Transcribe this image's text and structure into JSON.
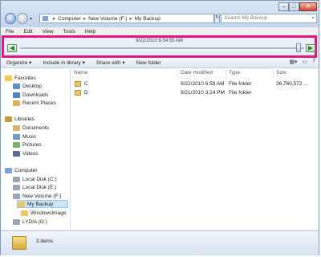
{
  "titlebar": {
    "minimize": "–",
    "maximize": "□",
    "close": "✕"
  },
  "address": {
    "crumbs": [
      "Computer",
      "New Volume (F:)",
      "My Backup"
    ]
  },
  "search": {
    "placeholder": "Search My Backup"
  },
  "menu": [
    "File",
    "Edit",
    "View",
    "Tools",
    "Help"
  ],
  "timeline": {
    "label": "9/22/2010 6:54:55 AM",
    "position": 0.98
  },
  "toolbar": {
    "organize": "Organize ▾",
    "include": "Include in library ▾",
    "share": "Share with ▾",
    "newfolder": "New folder"
  },
  "nav": {
    "favorites": "Favorites",
    "desktop": "Desktop",
    "downloads": "Downloads",
    "recent": "Recent Places",
    "libraries": "Libraries",
    "documents": "Documents",
    "music": "Music",
    "pictures": "Pictures",
    "videos": "Videos",
    "computer": "Computer",
    "c": "Local Disk (C:)",
    "e": "Local Disk (E:)",
    "f": "New Volume (F:)",
    "backup": "My Backup",
    "wim": "WindowsImage",
    "g": "LYDIA (G:)"
  },
  "columns": {
    "name": "Name",
    "date": "Date modified",
    "type": "Type",
    "size": "Size"
  },
  "files": [
    {
      "name": "C",
      "date": "9/22/2010 6:58 AM",
      "type": "File folder",
      "size": "36,760,572 ..."
    },
    {
      "name": "D",
      "date": "9/21/2010 3:24 PM",
      "type": "File folder",
      "size": ""
    }
  ],
  "status": {
    "count": "3 items"
  }
}
